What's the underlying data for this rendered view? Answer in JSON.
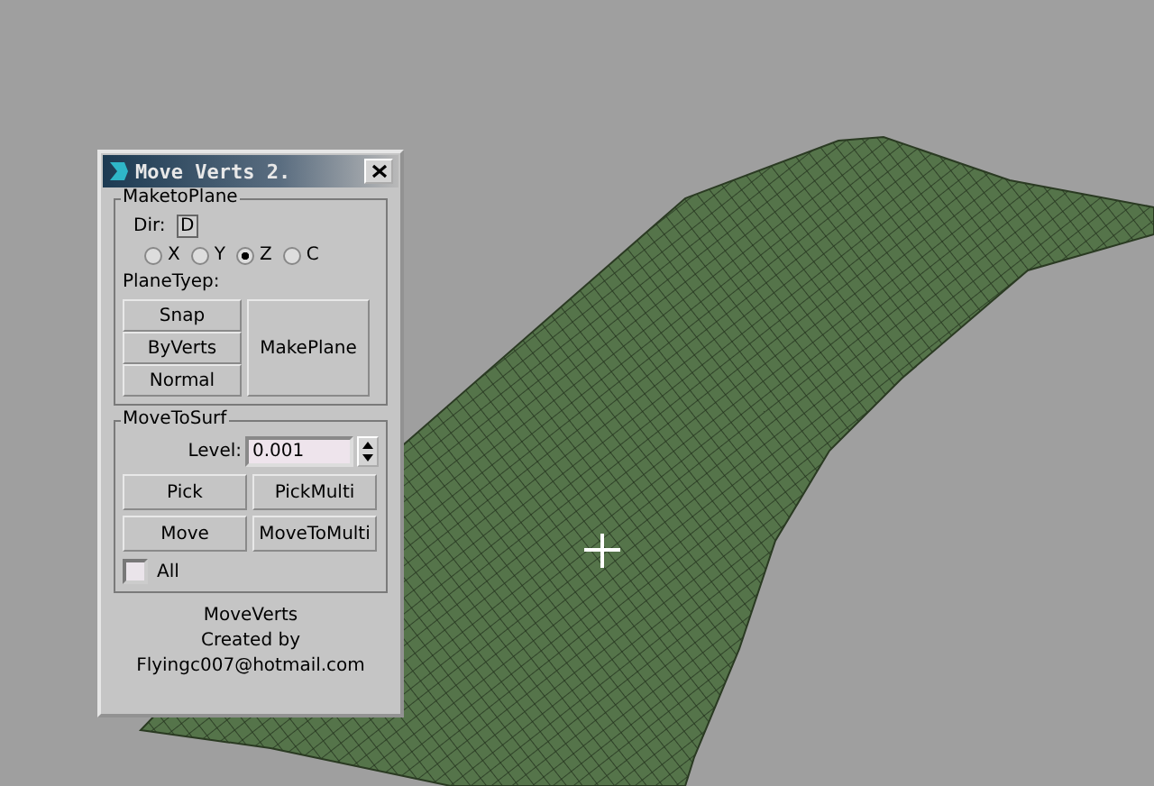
{
  "window": {
    "title": "Move Verts 2."
  },
  "make_to_plane": {
    "title": "MaketoPlane",
    "dir_label": "Dir:",
    "dir_button": "D",
    "axes": [
      {
        "label": "X",
        "selected": false
      },
      {
        "label": "Y",
        "selected": false
      },
      {
        "label": "Z",
        "selected": true
      },
      {
        "label": "C",
        "selected": false
      }
    ],
    "plane_type_label": "PlaneTyep:",
    "type_buttons": [
      "Snap",
      "ByVerts",
      "Normal"
    ],
    "make_button": "MakePlane"
  },
  "move_to_surf": {
    "title": "MoveToSurf",
    "level_label": "Level:",
    "level_value": "0.001",
    "buttons": [
      "Pick",
      "PickMulti",
      "Move",
      "MoveToMulti"
    ],
    "all_checkbox": {
      "label": "All",
      "checked": false
    }
  },
  "credits": [
    "MoveVerts",
    "Created by",
    "Flyingc007@hotmail.com"
  ]
}
